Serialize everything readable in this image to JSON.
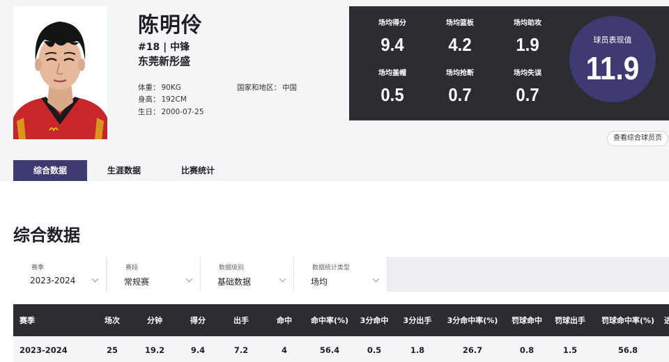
{
  "player": {
    "name": "陈明伶",
    "number_position": "#18 | 中锋",
    "team": "东莞新彤盛",
    "weight_label": "体重：",
    "weight": "90KG",
    "height_label": "身高：",
    "height": "192CM",
    "birthday_label": "生日：",
    "birthday": "2000-07-25",
    "country_label": "国家和地区：",
    "country": "中国"
  },
  "stats": [
    {
      "label": "场均得分",
      "value": "9.4"
    },
    {
      "label": "场均篮板",
      "value": "4.2"
    },
    {
      "label": "场均助攻",
      "value": "1.9"
    },
    {
      "label": "场均盖帽",
      "value": "0.5"
    },
    {
      "label": "场均抢断",
      "value": "0.7"
    },
    {
      "label": "场均失误",
      "value": "0.7"
    }
  ],
  "rating": {
    "label": "球员表现值",
    "value": "11.9"
  },
  "profile_button": "查看综合球员页",
  "tabs": [
    {
      "label": "综合数据",
      "active": true
    },
    {
      "label": "生涯数据",
      "active": false
    },
    {
      "label": "比赛统计",
      "active": false
    }
  ],
  "section_title": "综合数据",
  "filters": [
    {
      "label": "赛季",
      "value": "2023-2024"
    },
    {
      "label": "赛段",
      "value": "常规赛"
    },
    {
      "label": "数据级别",
      "value": "基础数据"
    },
    {
      "label": "数据统计类型",
      "value": "场均"
    }
  ],
  "table": {
    "headers": [
      "赛季",
      "场次",
      "分钟",
      "得分",
      "出手",
      "命中",
      "命中率(%)",
      "3分命中",
      "3分出手",
      "3分命中率(%)",
      "罚球命中",
      "罚球出手",
      "罚球命中率(%)",
      "进"
    ],
    "rows": [
      [
        "2023-2024",
        "25",
        "19.2",
        "9.4",
        "7.2",
        "4",
        "56.4",
        "0.5",
        "1.8",
        "26.7",
        "0.8",
        "1.5",
        "56.8",
        ""
      ]
    ]
  },
  "colors": {
    "accent": "#3e3b73",
    "dark_panel": "#2b2d33",
    "background": "#f4f5f7"
  }
}
